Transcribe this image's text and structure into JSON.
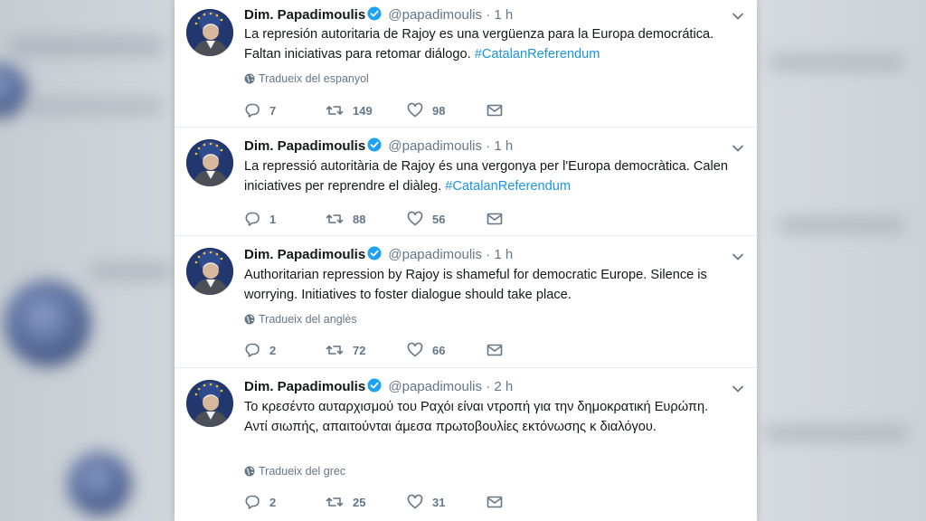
{
  "tweets": [
    {
      "name": "Dim. Papadimoulis",
      "handle": "@papadimoulis",
      "sep": "·",
      "time": "1 h",
      "text": "La represión autoritaria de Rajoy es una vergüenza para la Europa democrática. Faltan iniciativas para retomar diálogo. ",
      "hashtag": "#CatalanReferendum",
      "translate": "Tradueix del espanyol",
      "replies": "7",
      "retweets": "149",
      "likes": "98"
    },
    {
      "name": "Dim. Papadimoulis",
      "handle": "@papadimoulis",
      "sep": "·",
      "time": "1 h",
      "text": "La repressió autoritària de Rajoy és una vergonya per l'Europa democràtica. Calen iniciatives per reprendre el diàleg. ",
      "hashtag": "#CatalanReferendum",
      "translate": "",
      "replies": "1",
      "retweets": "88",
      "likes": "56"
    },
    {
      "name": "Dim. Papadimoulis",
      "handle": "@papadimoulis",
      "sep": "·",
      "time": "1 h",
      "text": "Authoritarian repression by Rajoy is shameful for democratic Europe. Silence is worrying. Initiatives to foster dialogue should take place.",
      "hashtag": "",
      "translate": "Tradueix del anglès",
      "replies": "2",
      "retweets": "72",
      "likes": "66"
    },
    {
      "name": "Dim. Papadimoulis",
      "handle": "@papadimoulis",
      "sep": "·",
      "time": "2 h",
      "text": "Το κρεσέντο αυταρχισμού του Ραχόι είναι ντροπή για την δημοκρατική Ευρώπη. Αντί σιωπής, απαιτούνται άμεσα πρωτοβουλίες εκτόνωσης κ διαλόγου.",
      "hashtag": "",
      "translate": "Tradueix del grec",
      "replies": "2",
      "retweets": "25",
      "likes": "31"
    }
  ],
  "colors": {
    "link": "#1b95e0",
    "muted": "#657786",
    "text": "#14171a",
    "verified": "#1da1f2"
  },
  "icons": [
    "verified-badge-icon",
    "chevron-down-icon",
    "globe-icon",
    "reply-icon",
    "retweet-icon",
    "like-icon",
    "message-icon"
  ]
}
